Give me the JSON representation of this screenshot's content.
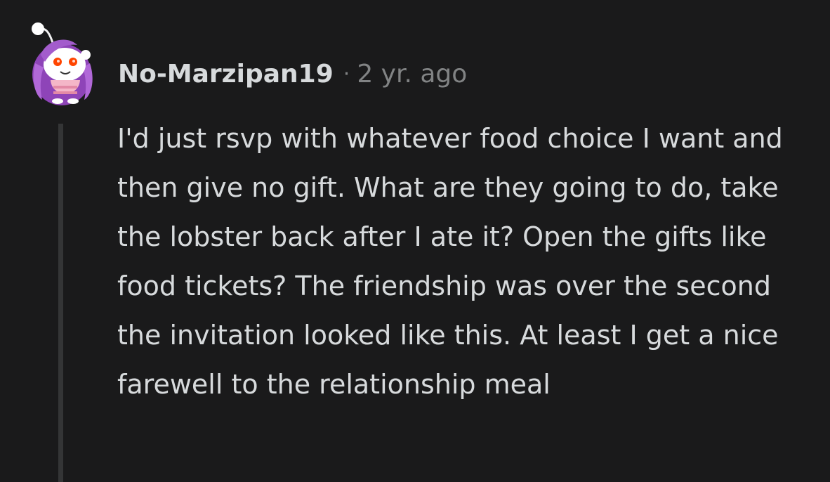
{
  "comment": {
    "author": "No-Marzipan19",
    "separator": "·",
    "timestamp": "2 yr. ago",
    "body": "I'd just rsvp with whatever food choice I want and then give no gift. What are they going to do, take the lobster back after I ate it? Open the gifts like food tickets? The friendship was over the second the invitation looked like this. At least I get a nice farewell to the relationship meal",
    "avatar_icon": "snoo-avatar-icon"
  },
  "colors": {
    "background": "#1a1a1b",
    "text": "#d7dadc",
    "meta": "#818384",
    "thread_line": "#343536",
    "avatar_hair": "#9b4fc4",
    "avatar_eyes": "#ff4500"
  }
}
